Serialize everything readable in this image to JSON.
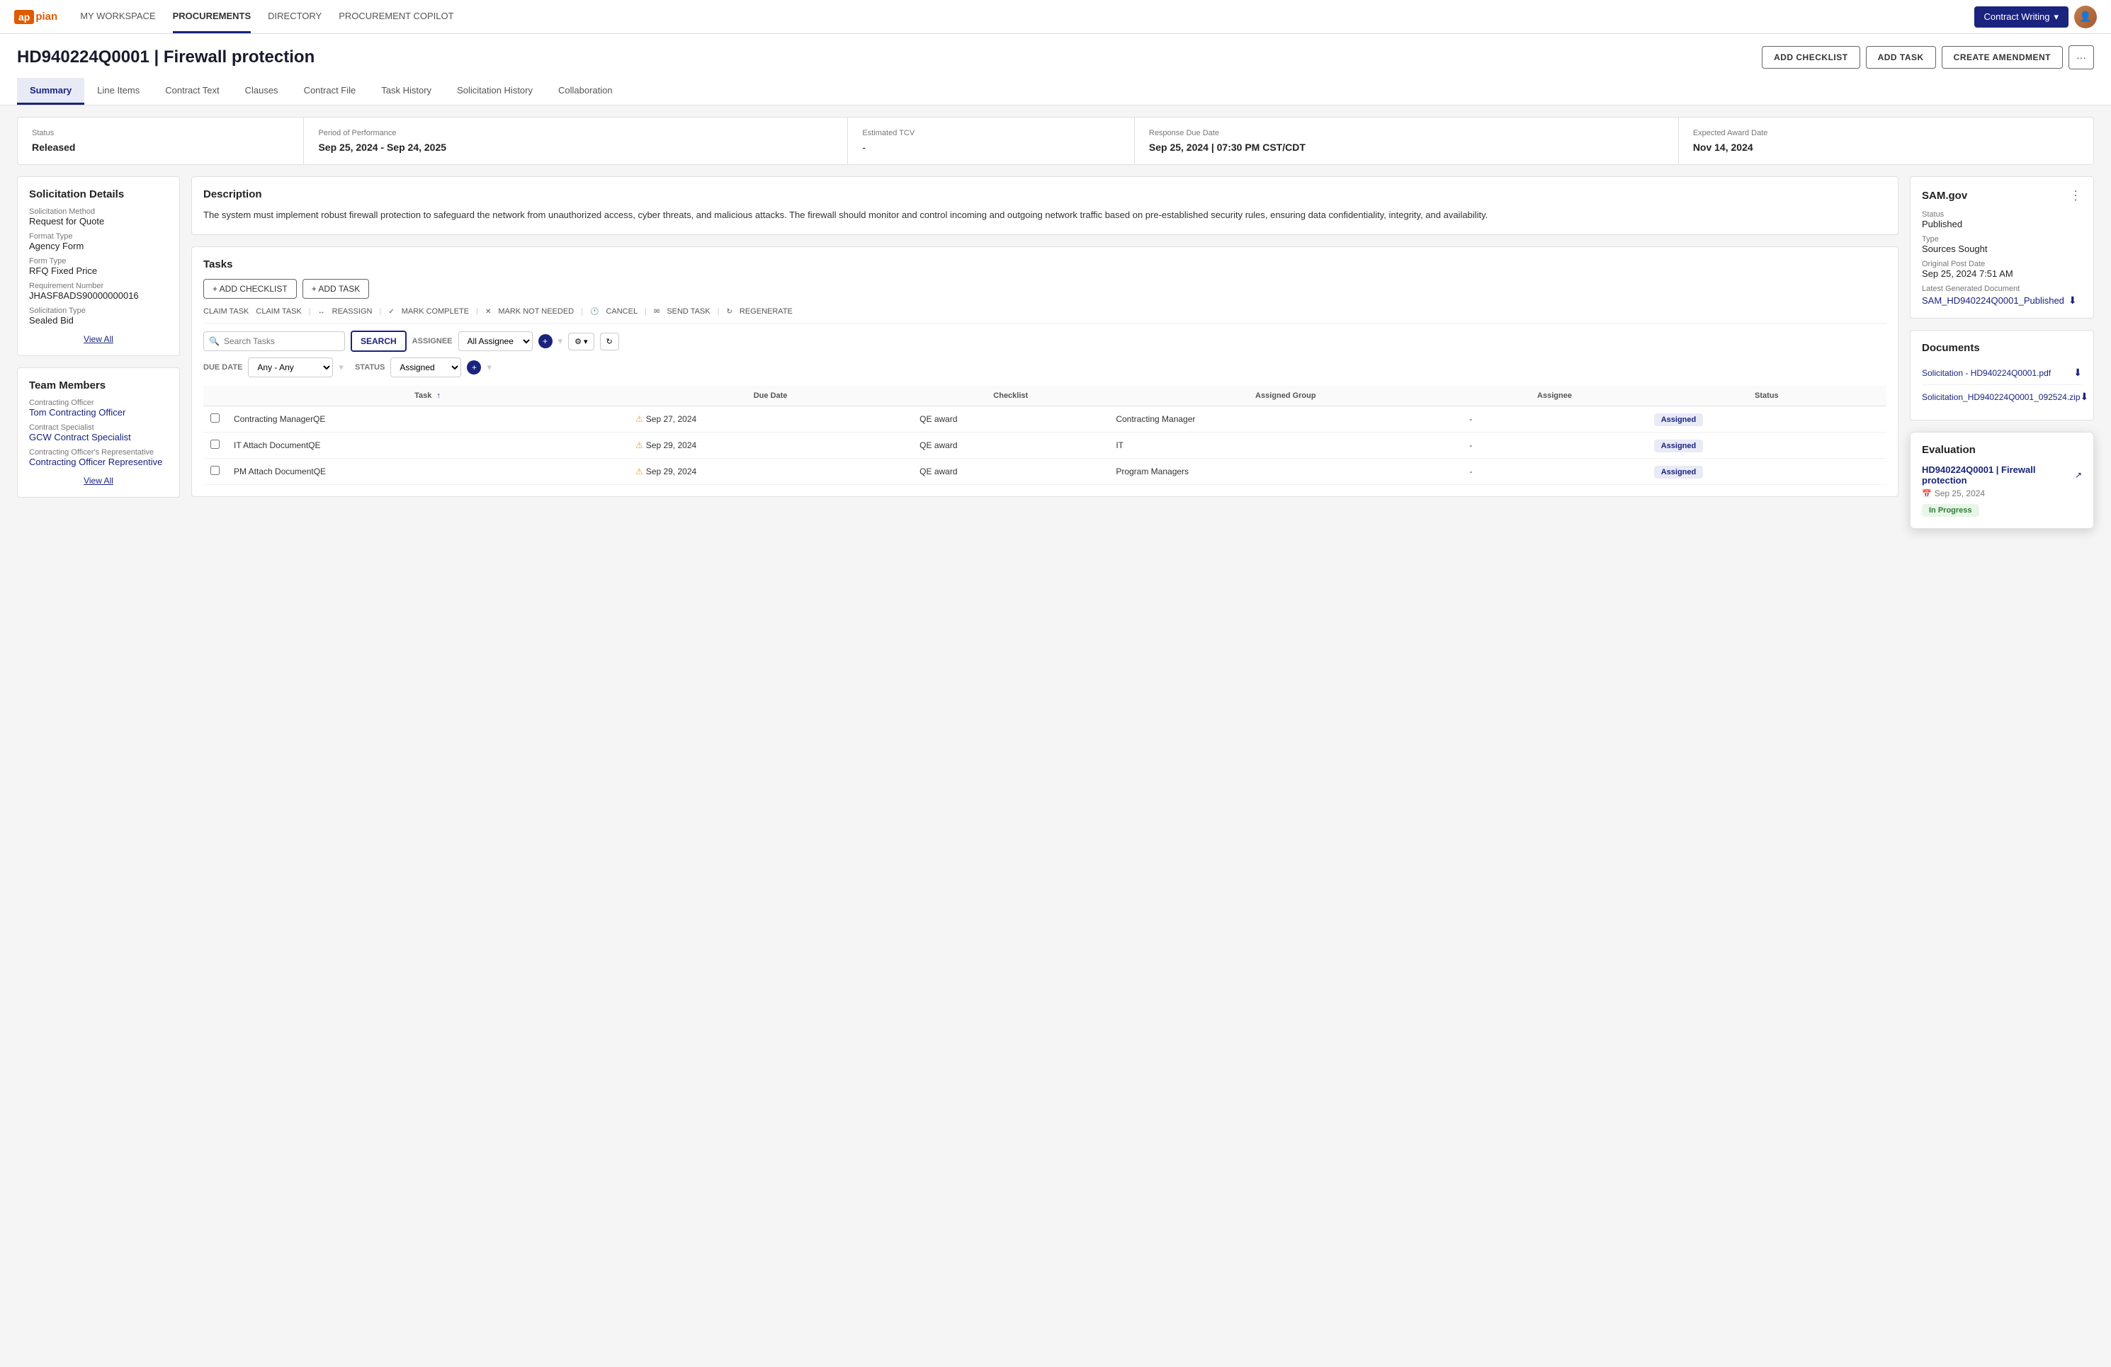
{
  "topnav": {
    "logo": "appian",
    "nav_items": [
      {
        "label": "MY WORKSPACE",
        "active": false
      },
      {
        "label": "PROCUREMENTS",
        "active": true
      },
      {
        "label": "DIRECTORY",
        "active": false
      },
      {
        "label": "PROCUREMENT COPILOT",
        "active": false
      }
    ],
    "contract_writing": "Contract Writing",
    "avatar_alt": "User Avatar"
  },
  "page_header": {
    "title": "HD940224Q0001 | Firewall protection",
    "actions": {
      "add_checklist": "ADD CHECKLIST",
      "add_task": "ADD TASK",
      "create_amendment": "CREATE AMENDMENT",
      "more": "···"
    }
  },
  "tabs": [
    {
      "label": "Summary",
      "active": true
    },
    {
      "label": "Line Items",
      "active": false
    },
    {
      "label": "Contract Text",
      "active": false
    },
    {
      "label": "Clauses",
      "active": false
    },
    {
      "label": "Contract File",
      "active": false
    },
    {
      "label": "Task History",
      "active": false
    },
    {
      "label": "Solicitation History",
      "active": false
    },
    {
      "label": "Collaboration",
      "active": false
    }
  ],
  "status_bar": {
    "status": {
      "label": "Status",
      "value": "Released"
    },
    "period": {
      "label": "Period of Performance",
      "value": "Sep 25, 2024 - Sep 24, 2025"
    },
    "tcv": {
      "label": "Estimated TCV",
      "value": "-"
    },
    "response_due": {
      "label": "Response Due Date",
      "value": "Sep 25, 2024 | 07:30 PM CST/CDT"
    },
    "award_date": {
      "label": "Expected Award Date",
      "value": "Nov 14, 2024"
    }
  },
  "solicitation_details": {
    "title": "Solicitation Details",
    "method_label": "Solicitation Method",
    "method_value": "Request for Quote",
    "format_label": "Format Type",
    "format_value": "Agency Form",
    "form_label": "Form Type",
    "form_value": "RFQ Fixed Price",
    "req_label": "Requirement Number",
    "req_value": "JHASF8ADS90000000016",
    "sol_type_label": "Solicitation Type",
    "sol_type_value": "Sealed Bid",
    "view_all": "View All"
  },
  "description": {
    "title": "Description",
    "text": "The system must implement robust firewall protection to safeguard the network from unauthorized access, cyber threats, and malicious attacks. The firewall should monitor and control incoming and outgoing network traffic based on pre-established security rules, ensuring data confidentiality, integrity, and availability."
  },
  "tasks": {
    "title": "Tasks",
    "add_checklist": "+ ADD CHECKLIST",
    "add_task": "+ ADD TASK",
    "toolbar": {
      "claim": "CLAIM TASK",
      "reassign": "REASSIGN",
      "mark_complete": "MARK COMPLETE",
      "mark_not_needed": "MARK NOT NEEDED",
      "cancel": "CANCEL",
      "send_task": "SEND TASK",
      "regenerate": "REGENERATE"
    },
    "search_placeholder": "Search Tasks",
    "search_btn": "SEARCH",
    "assignee_label": "ASSIGNEE",
    "assignee_value": "All Assignee",
    "due_date_label": "DUE DATE",
    "due_date_value": "Any - Any",
    "status_label": "STATUS",
    "status_value": "Assigned",
    "columns": [
      "Task",
      "Due Date",
      "Checklist",
      "Assigned Group",
      "Assignee",
      "Status"
    ],
    "rows": [
      {
        "task": "Contracting ManagerQE",
        "due_date": "Sep 27, 2024",
        "warning": true,
        "checklist": "QE award",
        "assigned_group": "Contracting Manager",
        "assignee": "-",
        "status": "Assigned"
      },
      {
        "task": "IT  Attach DocumentQE",
        "due_date": "Sep 29, 2024",
        "warning": true,
        "checklist": "QE award",
        "assigned_group": "IT",
        "assignee": "-",
        "status": "Assigned"
      },
      {
        "task": "PM  Attach DocumentQE",
        "due_date": "Sep 29, 2024",
        "warning": true,
        "checklist": "QE award",
        "assigned_group": "Program Managers",
        "assignee": "-",
        "status": "Assigned"
      }
    ]
  },
  "team_members": {
    "title": "Team Members",
    "contracting_officer_label": "Contracting Officer",
    "contracting_officer": "Tom Contracting Officer",
    "contract_specialist_label": "Contract Specialist",
    "contract_specialist": "GCW Contract Specialist",
    "cor_label": "Contracting Officer's Representative",
    "cor": "Contracting Officer Representive",
    "view_all": "View All"
  },
  "sam_gov": {
    "title": "SAM.gov",
    "status_label": "Status",
    "status_value": "Published",
    "type_label": "Type",
    "type_value": "Sources Sought",
    "post_date_label": "Original Post Date",
    "post_date_value": "Sep 25, 2024 7:51 AM",
    "latest_doc_label": "Latest Generated Document",
    "latest_doc_value": "SAM_HD940224Q0001_Published"
  },
  "documents": {
    "title": "Documents",
    "items": [
      {
        "name": "Solicitation - HD940224Q0001.pdf"
      },
      {
        "name": "Solicitation_HD940224Q0001_092524.zip"
      }
    ]
  },
  "evaluation": {
    "title": "Evaluation",
    "link": "HD940224Q0001 | Firewall protection",
    "date": "Sep 25, 2024",
    "status": "In Progress"
  }
}
